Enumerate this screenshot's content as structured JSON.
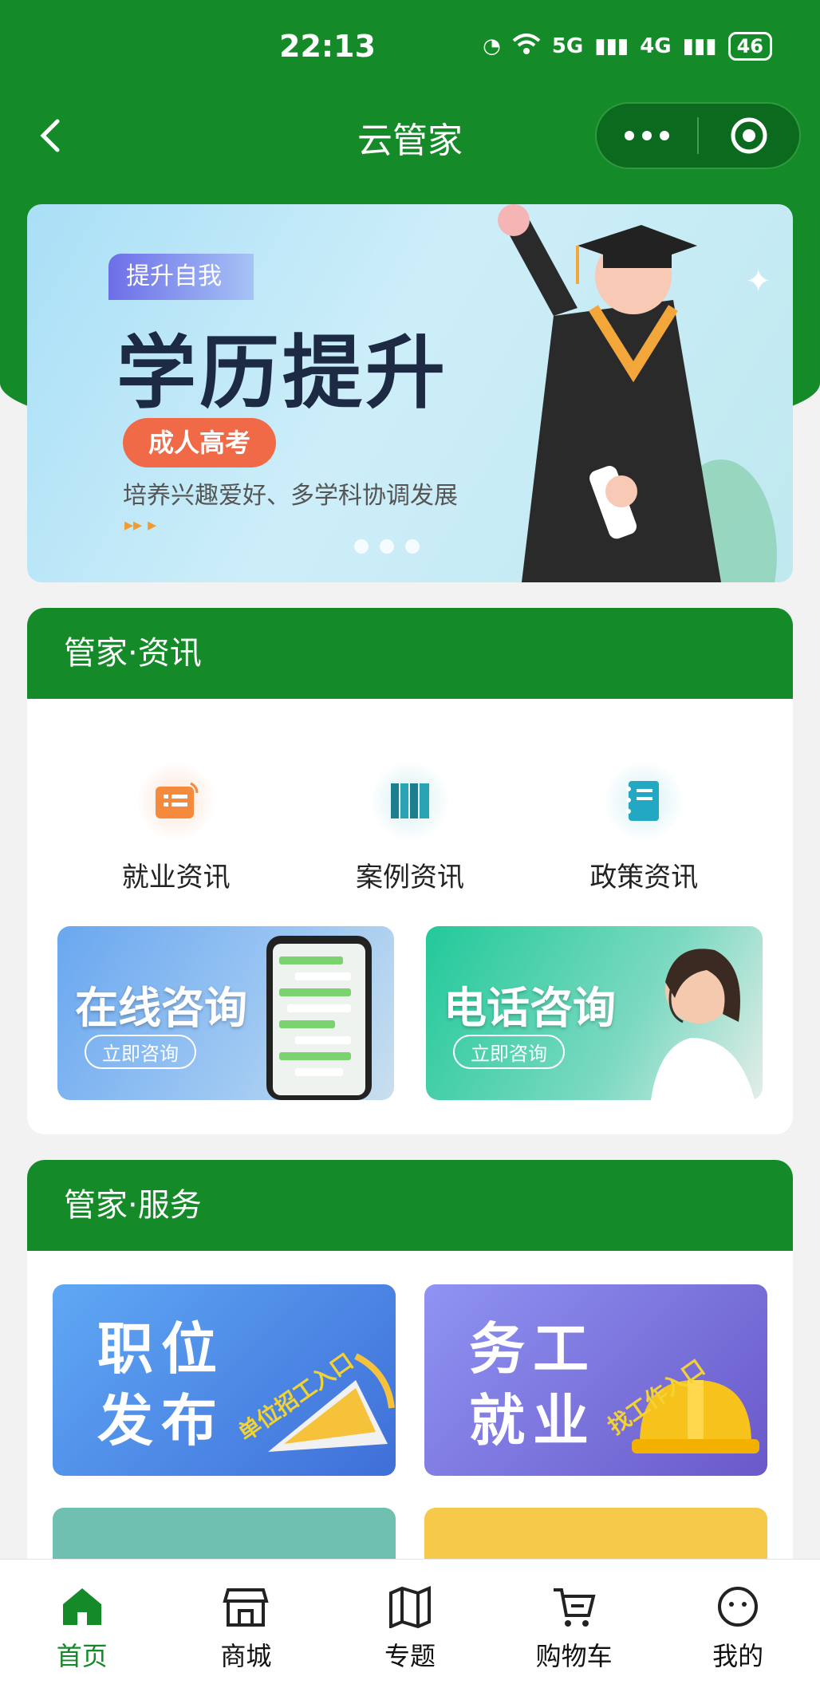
{
  "status": {
    "time": "22:13",
    "network1": "5G",
    "network2": "4G",
    "battery": "46"
  },
  "nav": {
    "title": "云管家"
  },
  "banner": {
    "tag": "提升自我",
    "headline": "学历提升",
    "pill": "成人高考",
    "subtitle": "培养兴趣爱好、多学科协调发展"
  },
  "news": {
    "title": "管家·资讯",
    "items": [
      {
        "label": "就业资讯",
        "icon": "news-icon"
      },
      {
        "label": "案例资讯",
        "icon": "books-icon"
      },
      {
        "label": "政策资讯",
        "icon": "notebook-icon"
      }
    ],
    "consult": [
      {
        "title": "在线咨询",
        "button": "立即咨询"
      },
      {
        "title": "电话咨询",
        "button": "立即咨询"
      }
    ]
  },
  "service": {
    "title": "管家·服务",
    "cards": [
      {
        "title": "职位发布",
        "stamp": "单位招工入口"
      },
      {
        "title": "务工就业",
        "stamp": "找工作入口"
      }
    ]
  },
  "tabs": [
    {
      "label": "首页",
      "icon": "home-icon",
      "active": true
    },
    {
      "label": "商城",
      "icon": "store-icon"
    },
    {
      "label": "专题",
      "icon": "map-icon"
    },
    {
      "label": "购物车",
      "icon": "cart-icon"
    },
    {
      "label": "我的",
      "icon": "profile-icon"
    }
  ],
  "colors": {
    "brand": "#148a28",
    "accent": "#f06a47"
  }
}
